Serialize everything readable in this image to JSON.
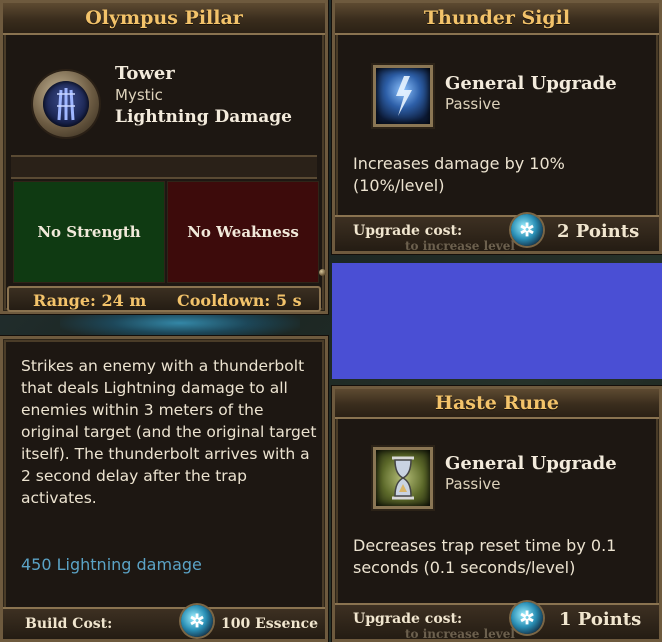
{
  "tower_card": {
    "title": "Olympus Pillar",
    "type": "Tower",
    "school": "Mystic",
    "damage_type": "Lightning Damage",
    "strength": "No Strength",
    "weakness": "No Weakness",
    "range": "Range: 24 m",
    "cooldown": "Cooldown: 5 s",
    "description": "Strikes an enemy with a thunderbolt that deals Lightning damage to all enemies within 3 meters of the original target (and the original target itself). The thunderbolt arrives with a 2 second delay after the trap activates.",
    "damage_stat": "450 Lightning damage",
    "build_cost_label": "Build Cost:",
    "build_cost_value": "100 Essence",
    "icon": "lightning-pillar-icon",
    "strength_color": "#0f3a12",
    "weakness_color": "#3d0b0b",
    "stat_color": "#5ba3c6"
  },
  "upgrade_1": {
    "title": "Thunder Sigil",
    "category": "General Upgrade",
    "kind": "Passive",
    "description": "Increases damage by 10% (10%/level)",
    "cost_label": "Upgrade cost:",
    "cost_value": "2 Points",
    "hidden_hint": "to increase level",
    "icon": "thunder-sigil-icon"
  },
  "upgrade_2": {
    "title": "Haste Rune",
    "category": "General Upgrade",
    "kind": "Passive",
    "description": "Decreases trap reset time by 0.1 seconds (0.1 seconds/level)",
    "cost_label": "Upgrade cost:",
    "cost_value": "1 Points",
    "hidden_hint": "to increase level",
    "icon": "hourglass-rune-icon"
  },
  "colors": {
    "title_gold": "#f3c36a",
    "blue_fill": "#4a4fd4"
  }
}
